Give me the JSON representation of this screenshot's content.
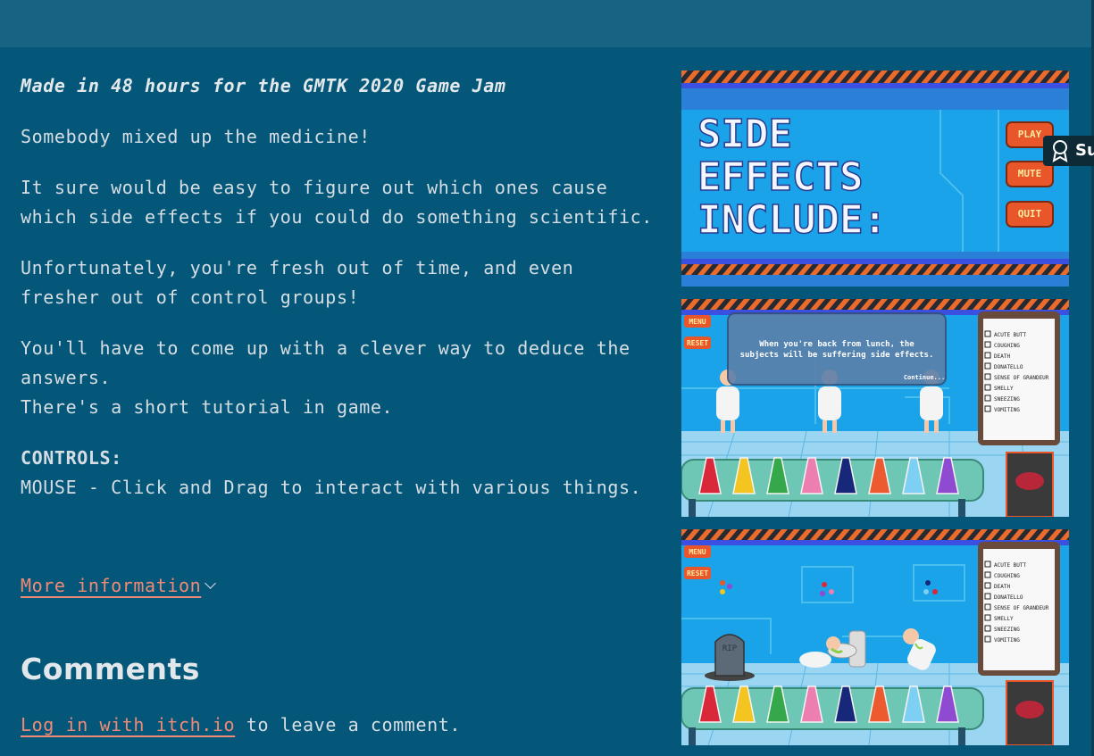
{
  "description": {
    "jam_line": "Made in 48 hours for the GMTK 2020 Game Jam",
    "paragraph_1": "Somebody mixed up the medicine!",
    "paragraph_2": "It sure would be easy to figure out which ones cause which side effects if you could do something scientific.",
    "paragraph_3": "Unfortunately, you're fresh out of time, and even fresher out of control groups!",
    "paragraph_4a": "You'll have to come up with a clever way to deduce the answers.",
    "paragraph_4b": "There's a short tutorial in game.",
    "controls_heading": "CONTROLS:",
    "controls_text": "MOUSE - Click and Drag to interact with various things."
  },
  "more_info_label": "More information",
  "comments": {
    "heading": "Comments",
    "login_link": "Log in with itch.io",
    "login_suffix": " to leave a comment."
  },
  "badge": {
    "label": "Su",
    "icon": "ribbon-icon"
  },
  "screenshots": {
    "title_screen": {
      "line1": "SIDE",
      "line2": "EFFECTS",
      "line3": "INCLUDE:",
      "buttons": [
        "PLAY",
        "MUTE",
        "QUIT"
      ]
    },
    "game_buttons": [
      "MENU",
      "RESET"
    ],
    "dialog_text_1": "When you're back from lunch, the",
    "dialog_text_2": "subjects will be suffering side effects.",
    "dialog_continue": "Continue...",
    "rip_text": "RIP",
    "checklist": [
      "ACUTE BUTT",
      "COUGHING",
      "DEATH",
      "DONATELLO",
      "SENSE OF GRANDEUR",
      "SMELLY",
      "SNEEZING",
      "VOMITING"
    ]
  },
  "colors": {
    "page_bg": "#05577a",
    "top_bar": "#176383",
    "link": "#f08a76",
    "text": "#d6dee3",
    "game_blue": "#1aa3e8"
  }
}
